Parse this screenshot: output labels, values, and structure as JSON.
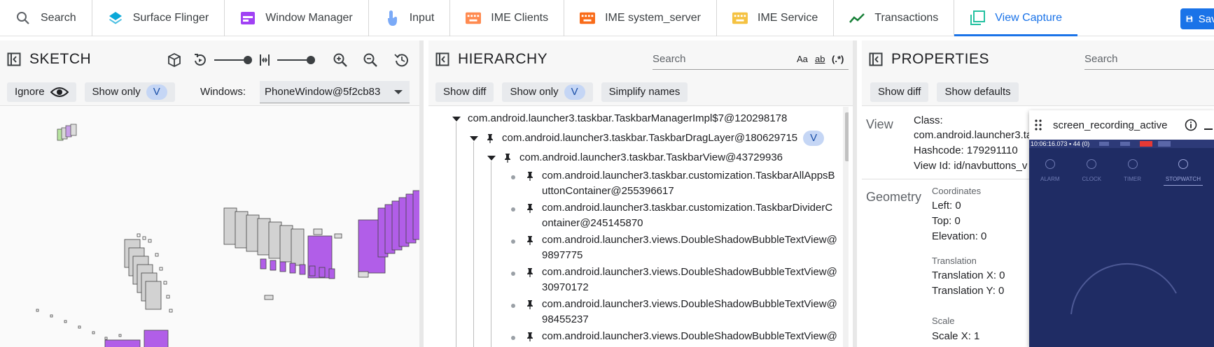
{
  "tabs": [
    {
      "label": "Search",
      "icon": "search-icon"
    },
    {
      "label": "Surface Flinger",
      "icon": "layers-icon"
    },
    {
      "label": "Window Manager",
      "icon": "window-icon"
    },
    {
      "label": "Input",
      "icon": "touch-icon"
    },
    {
      "label": "IME Clients",
      "icon": "keyboard-icon"
    },
    {
      "label": "IME system_server",
      "icon": "keyboard-icon"
    },
    {
      "label": "IME Service",
      "icon": "keyboard-icon"
    },
    {
      "label": "Transactions",
      "icon": "timeline-icon"
    },
    {
      "label": "View Capture",
      "icon": "capture-icon",
      "active": true
    }
  ],
  "colors": {
    "accent": "#1a73e8",
    "purple": "#b15ee8",
    "sf": "#0aa8d8",
    "wm": "#a142f4",
    "ime1": "#ff8a50",
    "ime2": "#f96c1a",
    "ime3": "#f5c242",
    "trans": "#188038",
    "vc": "#24c1a0"
  },
  "sketch": {
    "title": "SKETCH",
    "ignore_label": "Ignore",
    "show_only_label": "Show only",
    "show_only_badge": "V",
    "windows_label": "Windows:",
    "window_value": "PhoneWindow@5f2cb83"
  },
  "hierarchy": {
    "title": "HIERARCHY",
    "search_placeholder": "Search",
    "opt_case": "Aa",
    "opt_word": "ab",
    "opt_regex": "(.*)",
    "show_diff": "Show diff",
    "show_only": "Show only",
    "show_only_badge": "V",
    "simplify": "Simplify names",
    "nodes": [
      {
        "text": "com.android.launcher3.taskbar.TaskbarManagerImpl$7@120298178"
      },
      {
        "text": "com.android.launcher3.taskbar.TaskbarDragLayer@180629715",
        "badge": "V"
      },
      {
        "text": "com.android.launcher3.taskbar.TaskbarView@43729936"
      },
      {
        "line1": "com.android.launcher3.taskbar.customization.TaskbarAllAppsB",
        "line2": "uttonContainer@255396617"
      },
      {
        "line1": "com.android.launcher3.taskbar.customization.TaskbarDividerC",
        "line2": "ontainer@245145870"
      },
      {
        "line1": "com.android.launcher3.views.DoubleShadowBubbleTextView@",
        "line2": "9897775"
      },
      {
        "line1": "com.android.launcher3.views.DoubleShadowBubbleTextView@",
        "line2": "30970172"
      },
      {
        "line1": "com.android.launcher3.views.DoubleShadowBubbleTextView@",
        "line2": "98455237"
      },
      {
        "line1": "com.android.launcher3.views.DoubleShadowBubbleTextView@",
        "line2": ""
      }
    ]
  },
  "properties": {
    "title": "PROPERTIES",
    "search_placeholder": "Search",
    "show_diff": "Show diff",
    "show_defaults": "Show defaults",
    "view_label": "View",
    "class_label": "Class:",
    "class_value": "com.android.launcher3.ta",
    "hashcode": "Hashcode: 179291110",
    "view_id": "View Id: id/navbuttons_v",
    "geometry_label": "Geometry",
    "coordinates_label": "Coordinates",
    "left": "Left: 0",
    "top": "Top: 0",
    "elevation": "Elevation: 0",
    "translation_label": "Translation",
    "tx": "Translation X: 0",
    "ty": "Translation Y: 0",
    "scale_label": "Scale",
    "sx": "Scale X: 1"
  },
  "preview": {
    "title": "screen_recording_active",
    "status_text": "10:06:16.073 ▪ 44 (0)",
    "clock_tabs": [
      "ALARM",
      "CLOCK",
      "TIMER",
      "STOPWATCH"
    ],
    "active_tab": "STOPWATCH"
  },
  "save_label": "Save"
}
